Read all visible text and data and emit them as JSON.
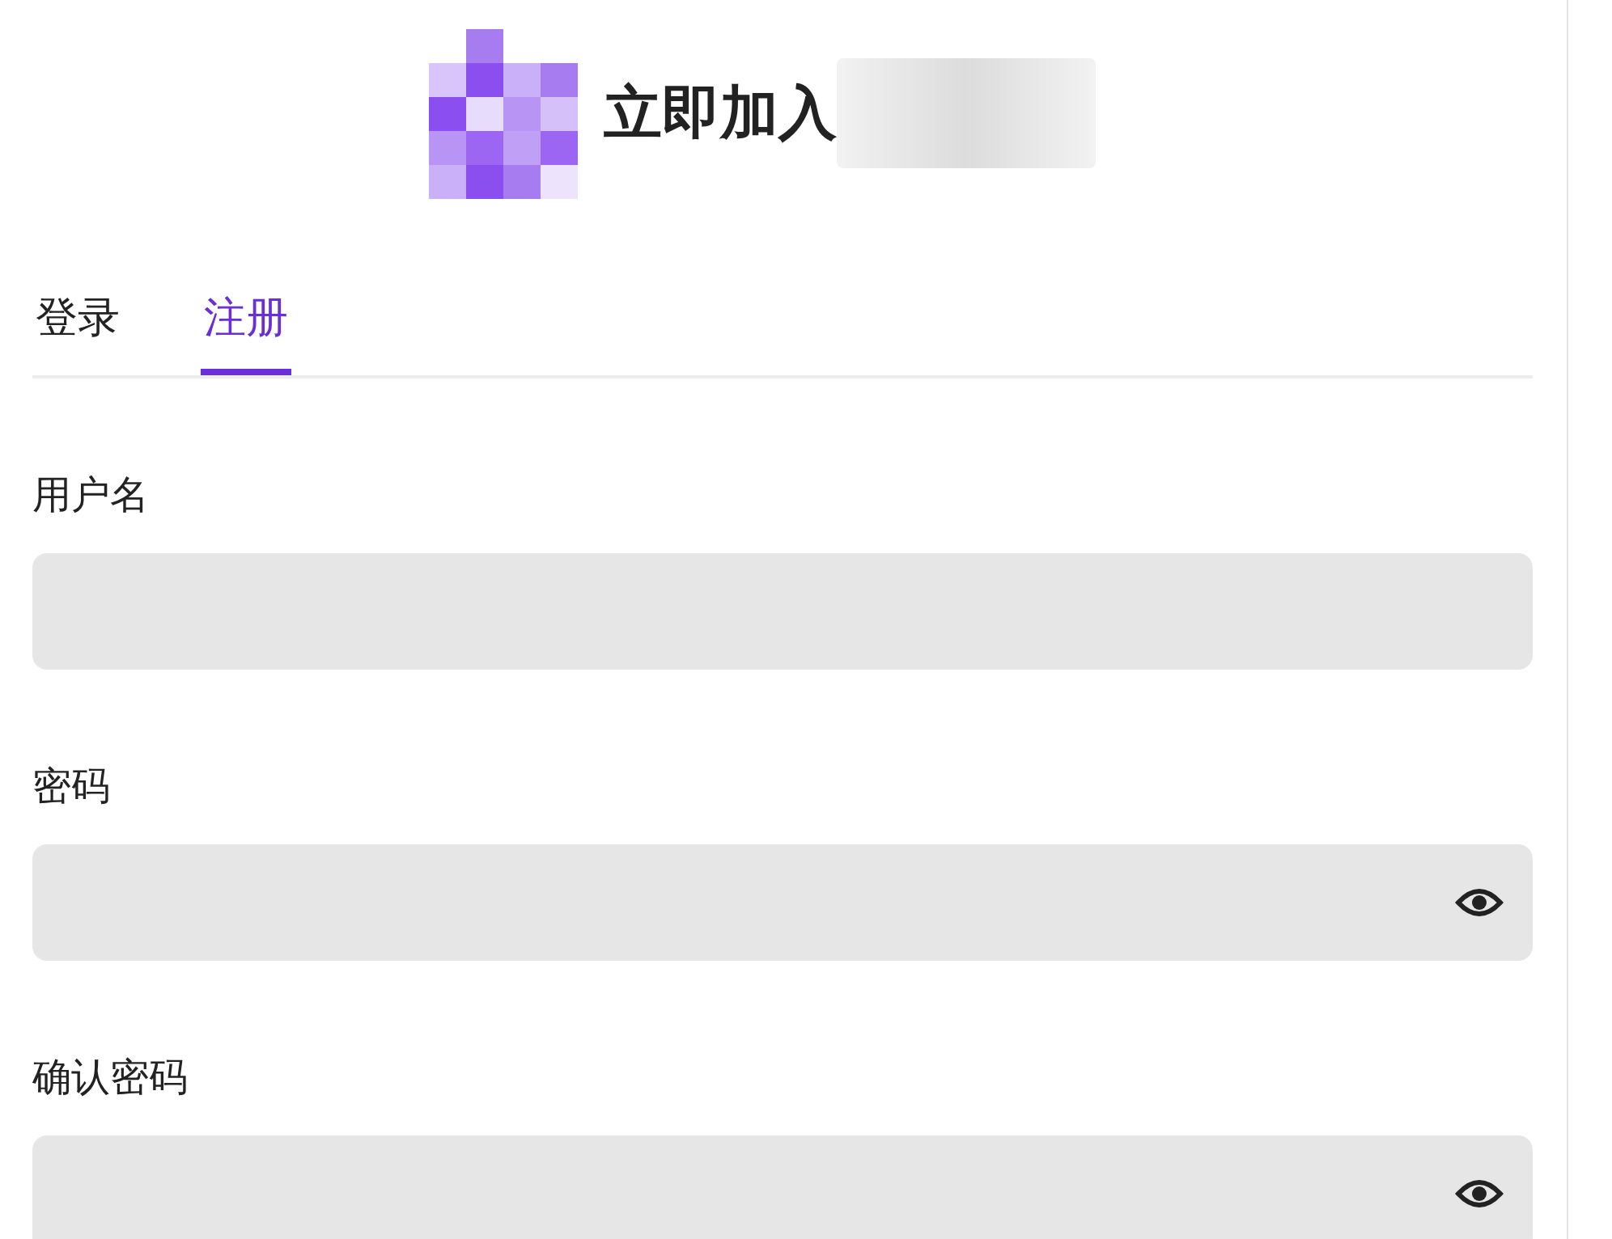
{
  "header": {
    "title": "立即加入"
  },
  "tabs": [
    {
      "label": "登录",
      "selected": false
    },
    {
      "label": "注册",
      "selected": true
    }
  ],
  "fields": [
    {
      "label": "用户名",
      "kind": "text"
    },
    {
      "label": "密码",
      "kind": "password"
    },
    {
      "label": "确认密码",
      "kind": "password"
    }
  ]
}
